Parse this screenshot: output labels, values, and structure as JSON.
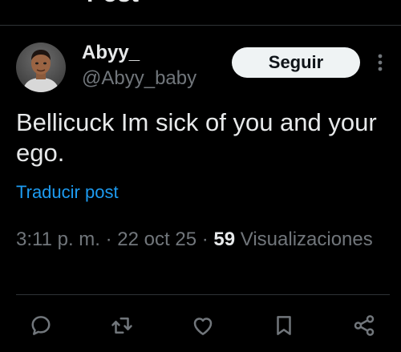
{
  "header": {
    "title": "Post"
  },
  "post": {
    "author": {
      "name": "Abyy_",
      "handle": "@Abyy_baby"
    },
    "follow_label": "Seguir",
    "text": "Bellicuck Im sick of you and your ego.",
    "translate_label": "Traducir post",
    "time": "3:11 p. m.",
    "separator": "·",
    "date": "22 oct 25",
    "views_count": "59",
    "views_label": "Visualizaciones"
  },
  "actions": [
    {
      "name": "reply",
      "icon": "reply-icon"
    },
    {
      "name": "repost",
      "icon": "repost-icon"
    },
    {
      "name": "like",
      "icon": "heart-icon"
    },
    {
      "name": "bookmark",
      "icon": "bookmark-icon"
    },
    {
      "name": "share",
      "icon": "share-icon"
    }
  ],
  "colors": {
    "background": "#000000",
    "text": "#e7e9ea",
    "secondary": "#71767b",
    "link": "#1d9bf0",
    "icon": "#71767b",
    "follow_bg": "#eff3f4"
  }
}
